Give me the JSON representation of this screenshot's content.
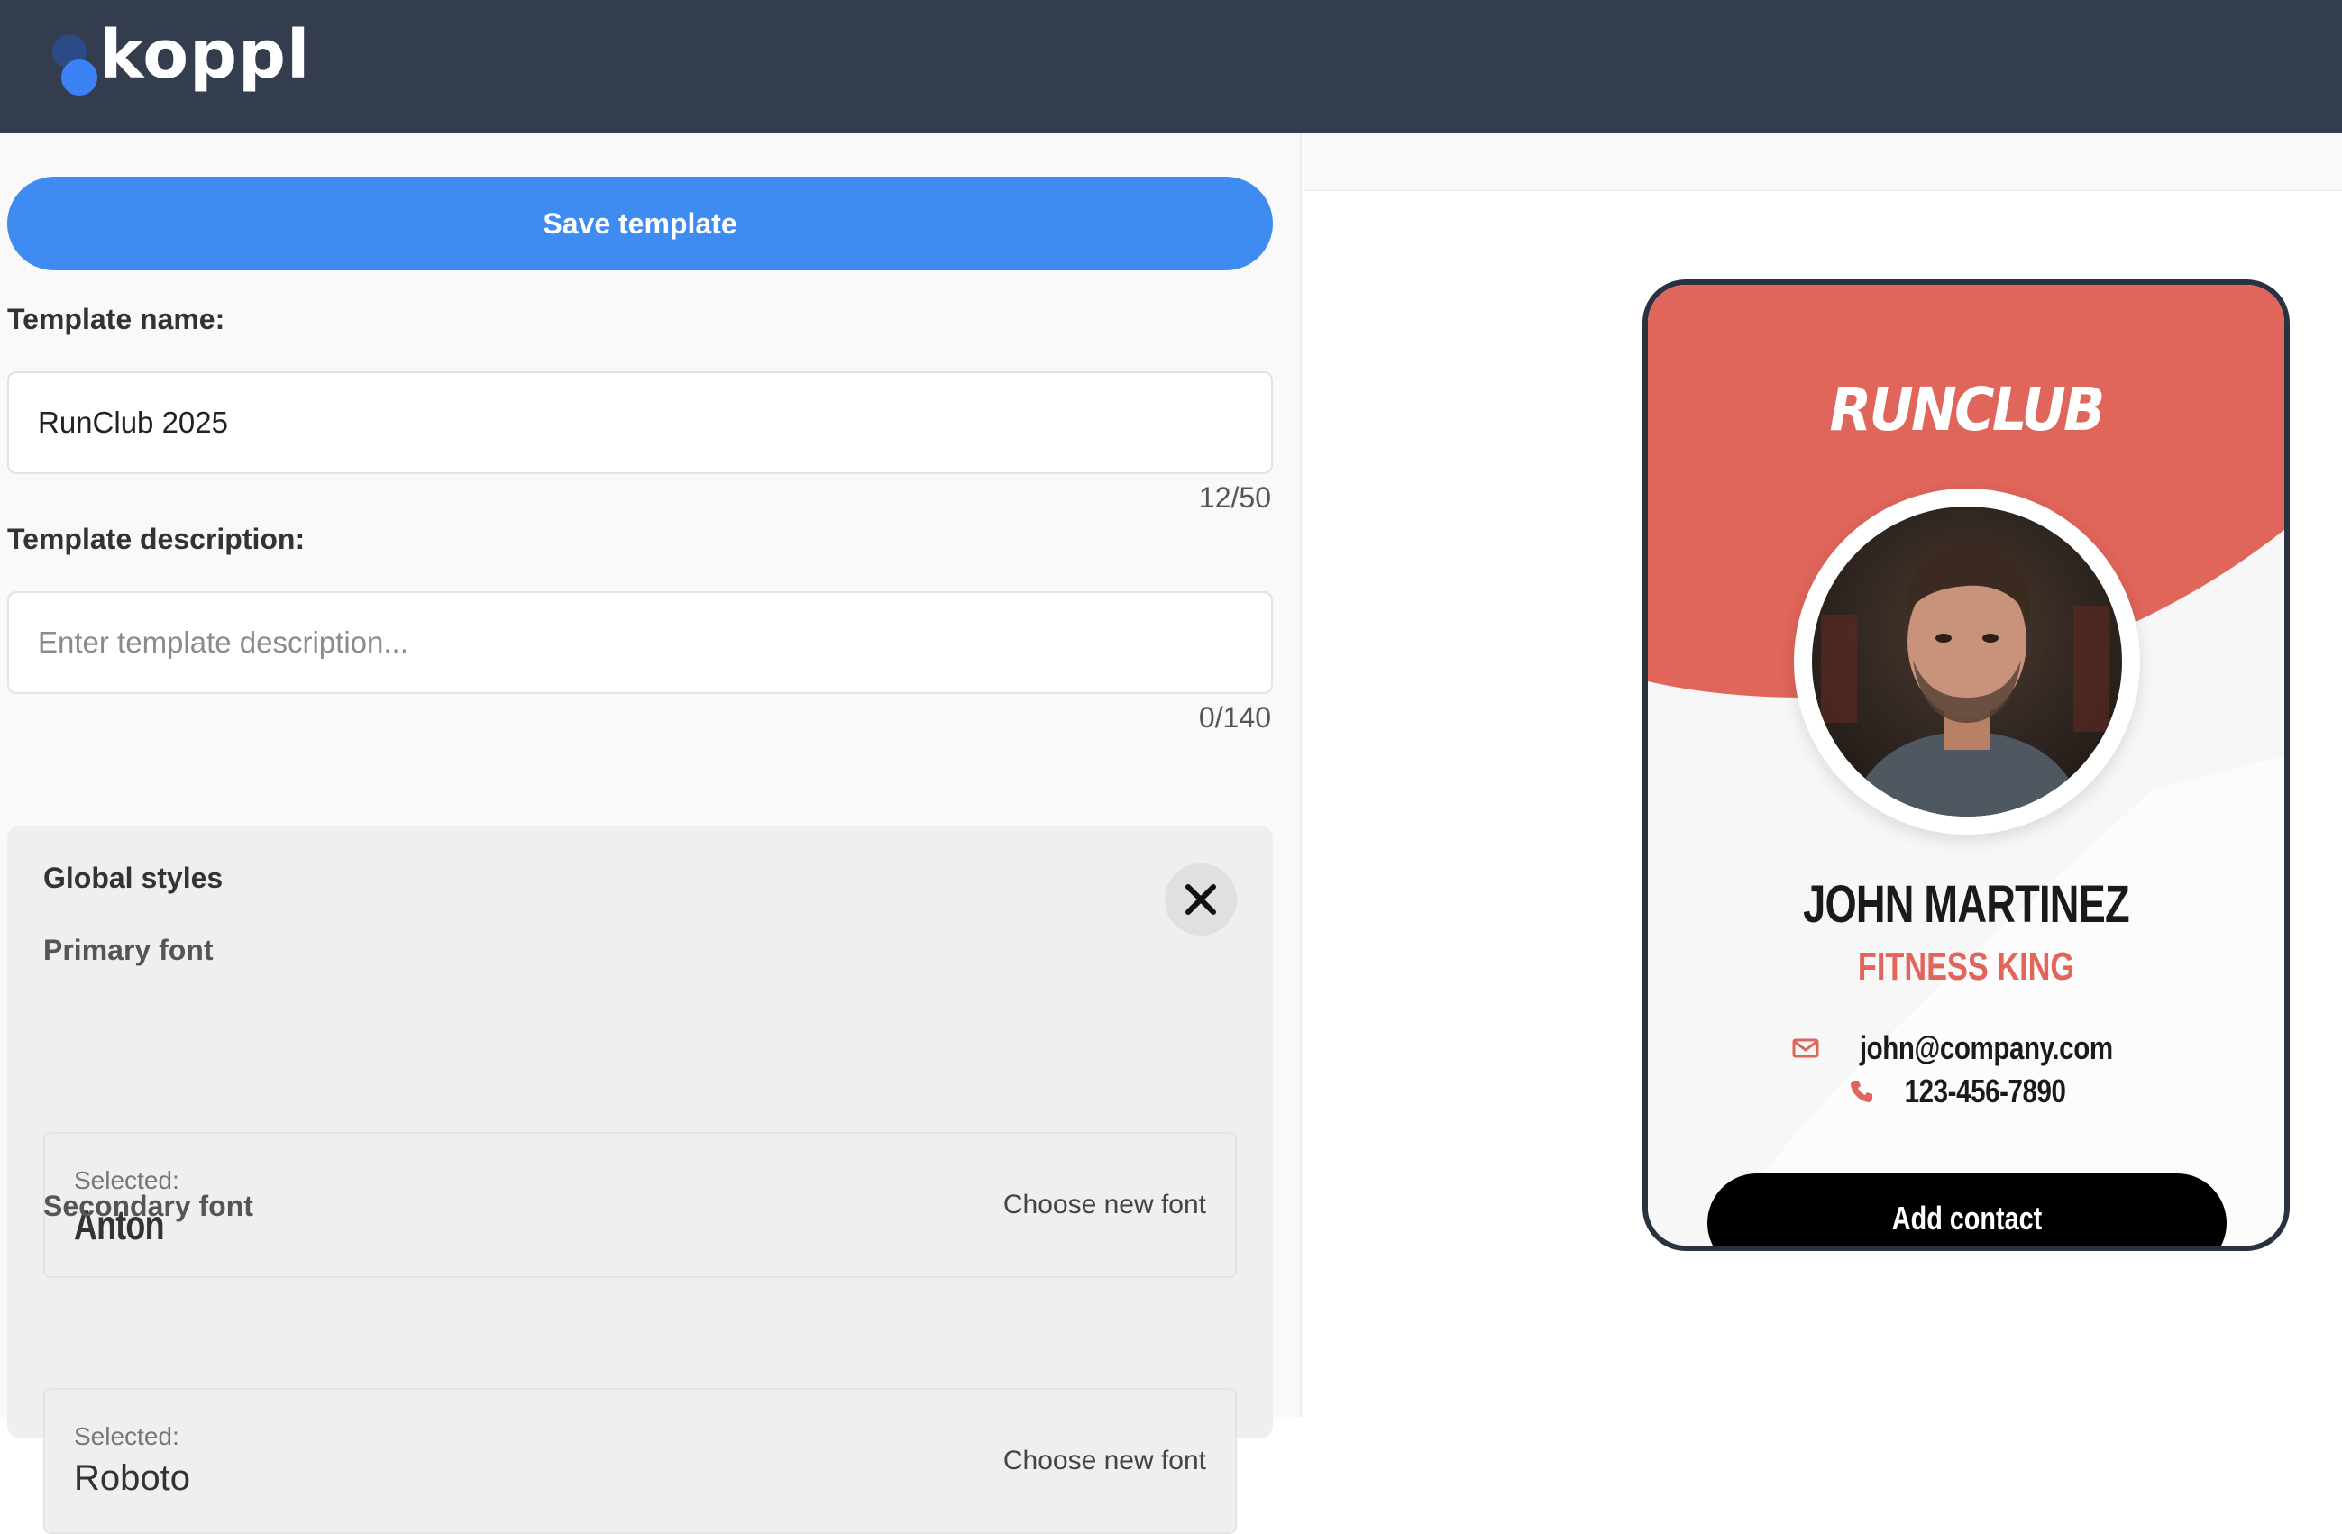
{
  "header": {
    "logo_text": "koppl"
  },
  "editor": {
    "save_label": "Save template",
    "name_label": "Template name:",
    "name_value": "RunClub 2025",
    "name_counter": "12/50",
    "description_label": "Template description:",
    "description_value": "",
    "description_placeholder": "Enter template description...",
    "description_counter": "0/140",
    "global_styles": {
      "title": "Global styles",
      "primary_font": {
        "label": "Primary font",
        "selected_label": "Selected:",
        "font_name": "Anton",
        "choose_label": "Choose new font"
      },
      "secondary_font": {
        "label": "Secondary font",
        "selected_label": "Selected:",
        "font_name": "Roboto",
        "choose_label": "Choose new font"
      }
    }
  },
  "preview": {
    "brand": "RUNCLUB",
    "name": "JOHN MARTINEZ",
    "title": "FITNESS KING",
    "email": "john@company.com",
    "phone": "123-456-7890",
    "add_contact_label": "Add contact",
    "accent_color": "#e0655a"
  },
  "colors": {
    "header_bg": "#333d4e",
    "primary_button": "#3e8cf2"
  }
}
